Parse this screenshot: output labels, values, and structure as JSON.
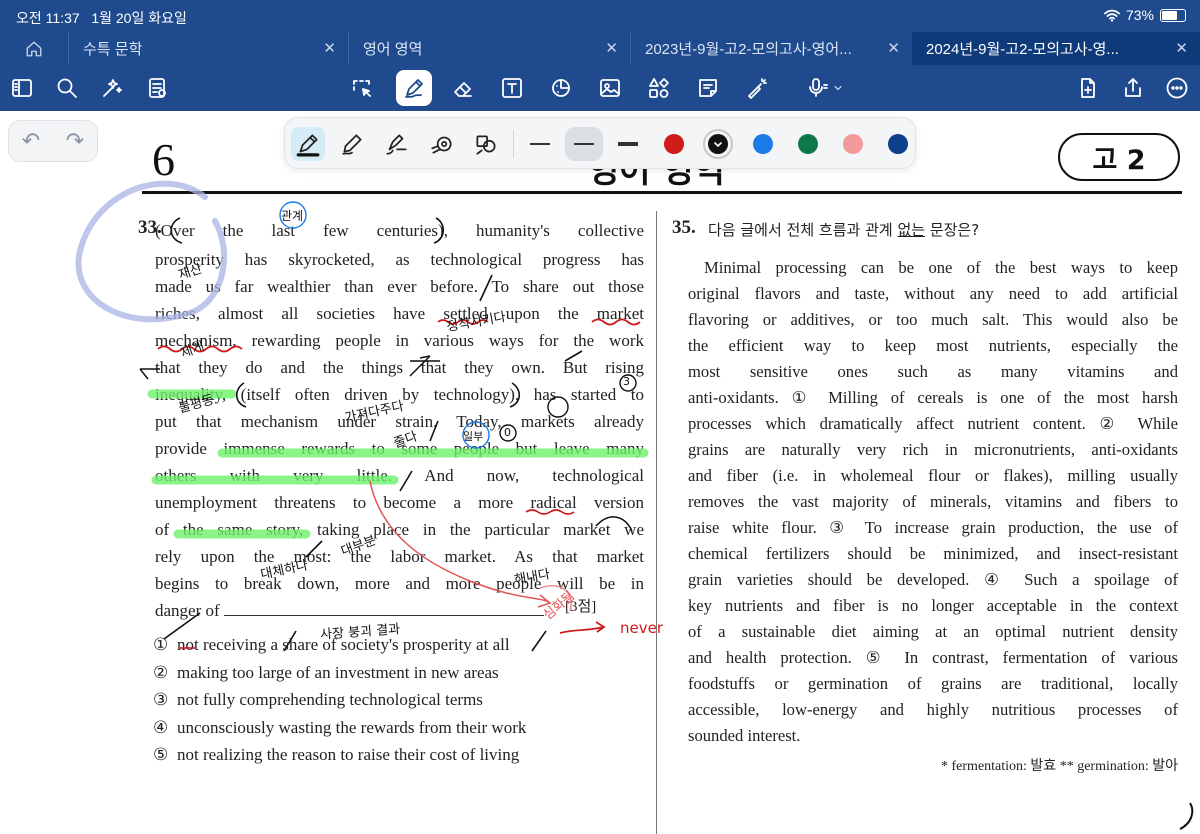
{
  "status_bar": {
    "time": "오전 11:37",
    "date": "1월 20일 화요일",
    "battery": "73%",
    "battery_level": 0.73
  },
  "tabs": [
    {
      "label": "수특 문학",
      "active": false
    },
    {
      "label": "영어 영역",
      "active": false
    },
    {
      "label": "2023년-9월-고2-모의고사-영어...",
      "active": false
    },
    {
      "label": "2024년-9월-고2-모의고사-영...",
      "active": true
    }
  ],
  "toolbar": {
    "icons": [
      "sidebar-icon",
      "search-icon",
      "ai-sparkle-icon",
      "document-list-icon",
      "lasso-icon",
      "pen-icon",
      "eraser-icon",
      "text-box-icon",
      "shapes-icon",
      "image-icon",
      "elements-icon",
      "sticky-note-icon",
      "laser-pointer-icon",
      "microphone-icon",
      "add-page-icon",
      "share-icon",
      "more-icon"
    ],
    "selected_tool": "pen"
  },
  "pen_palette": {
    "pen_types": [
      "fountain-pen",
      "ball-pen",
      "brush-pen",
      "highlighter-round",
      "shape-pen"
    ],
    "selected_pen": "fountain-pen",
    "thickness": [
      "thin",
      "medium",
      "thick"
    ],
    "selected_thickness": "medium",
    "colors": [
      "#d11a1a",
      "#111111",
      "#1a7ae6",
      "#0e7a4a",
      "#f29a9a",
      "#0c3e8c"
    ],
    "selected_color": "#111111"
  },
  "exam": {
    "page_number": "6",
    "subject": "영어 영역",
    "grade": "고 2",
    "q33": {
      "number": "33.",
      "lines": [
        "(Over the last few centuries), humanity's collective",
        "prosperity has skyrocketed, as technological progress has",
        "made us far wealthier than ever before. To share out those",
        "riches, almost all societies have settled upon the market",
        "mechanism, rewarding people in various ways for the work",
        "that they do and the things that they own. But rising",
        "inequality, (itself often driven by technology), has started to",
        "put that mechanism under strain. Today, markets already",
        "provide immense rewards to some people but leave many",
        "others with very little. And now, technological",
        "unemployment threatens to become a more radical version",
        "of the same story, taking place in the particular market we",
        "rely upon the most: the labor market. As that market",
        "begins to break down, more and more people will be in"
      ],
      "last_line_prefix": "danger of",
      "points": "[3점]",
      "options": [
        {
          "num": "①",
          "text": "not receiving a share of society's prosperity at all"
        },
        {
          "num": "②",
          "text": "making too large of an investment in new areas"
        },
        {
          "num": "③",
          "text": "not fully comprehending technological terms"
        },
        {
          "num": "④",
          "text": "unconsciously wasting the rewards from their work"
        },
        {
          "num": "⑤",
          "text": "not realizing the reason to raise their cost of living"
        }
      ]
    },
    "q35": {
      "number": "35.",
      "prompt_before": "다음 글에서 전체 흐름과 관계 ",
      "prompt_underlined": "없는",
      "prompt_after": " 문장은?",
      "lines": [
        "Minimal processing can be one of the best ways to keep",
        "original flavors and taste, without any need to add artificial",
        "flavoring or additives, or too much salt. This would also be",
        "the efficient way to keep most nutrients, especially the",
        "most sensitive ones such as many vitamins and",
        "anti-oxidants. ① Milling of cereals is one of the most harsh",
        "processes which dramatically affect nutrient content. ② While",
        "grains are naturally very rich in micronutrients, anti-oxidants",
        "and fiber (i.e. in wholemeal flour or flakes), milling usually",
        "removes the vast majority of minerals, vitamins and fibers to",
        "raise white flour. ③ To increase grain production, the use of",
        "chemical fertilizers should be minimized, and insect-resistant",
        "grain varieties should be developed. ④ Such a spoilage of",
        "key nutrients and fiber is no longer acceptable in the context",
        "of a sustainable diet aiming at an optimal nutrient density",
        "and health protection. ⑤ In contrast, fermentation of various",
        "foodstuffs or germination of grains are traditional, locally",
        "accessible, low-energy and highly nutritious processes of",
        "sounded interest."
      ],
      "footnote": "* fermentation: 발효   ** germination: 발아"
    }
  },
  "annotations": {
    "notes": [
      "관계",
      "재산",
      "제게",
      "정착시키다",
      "불평등",
      "가져다주다",
      "줄다",
      "일부",
      "대체하다",
      "대부분",
      "사장 붕괴 결과",
      "해내다",
      "심화됨",
      "never",
      "3",
      "0"
    ]
  }
}
